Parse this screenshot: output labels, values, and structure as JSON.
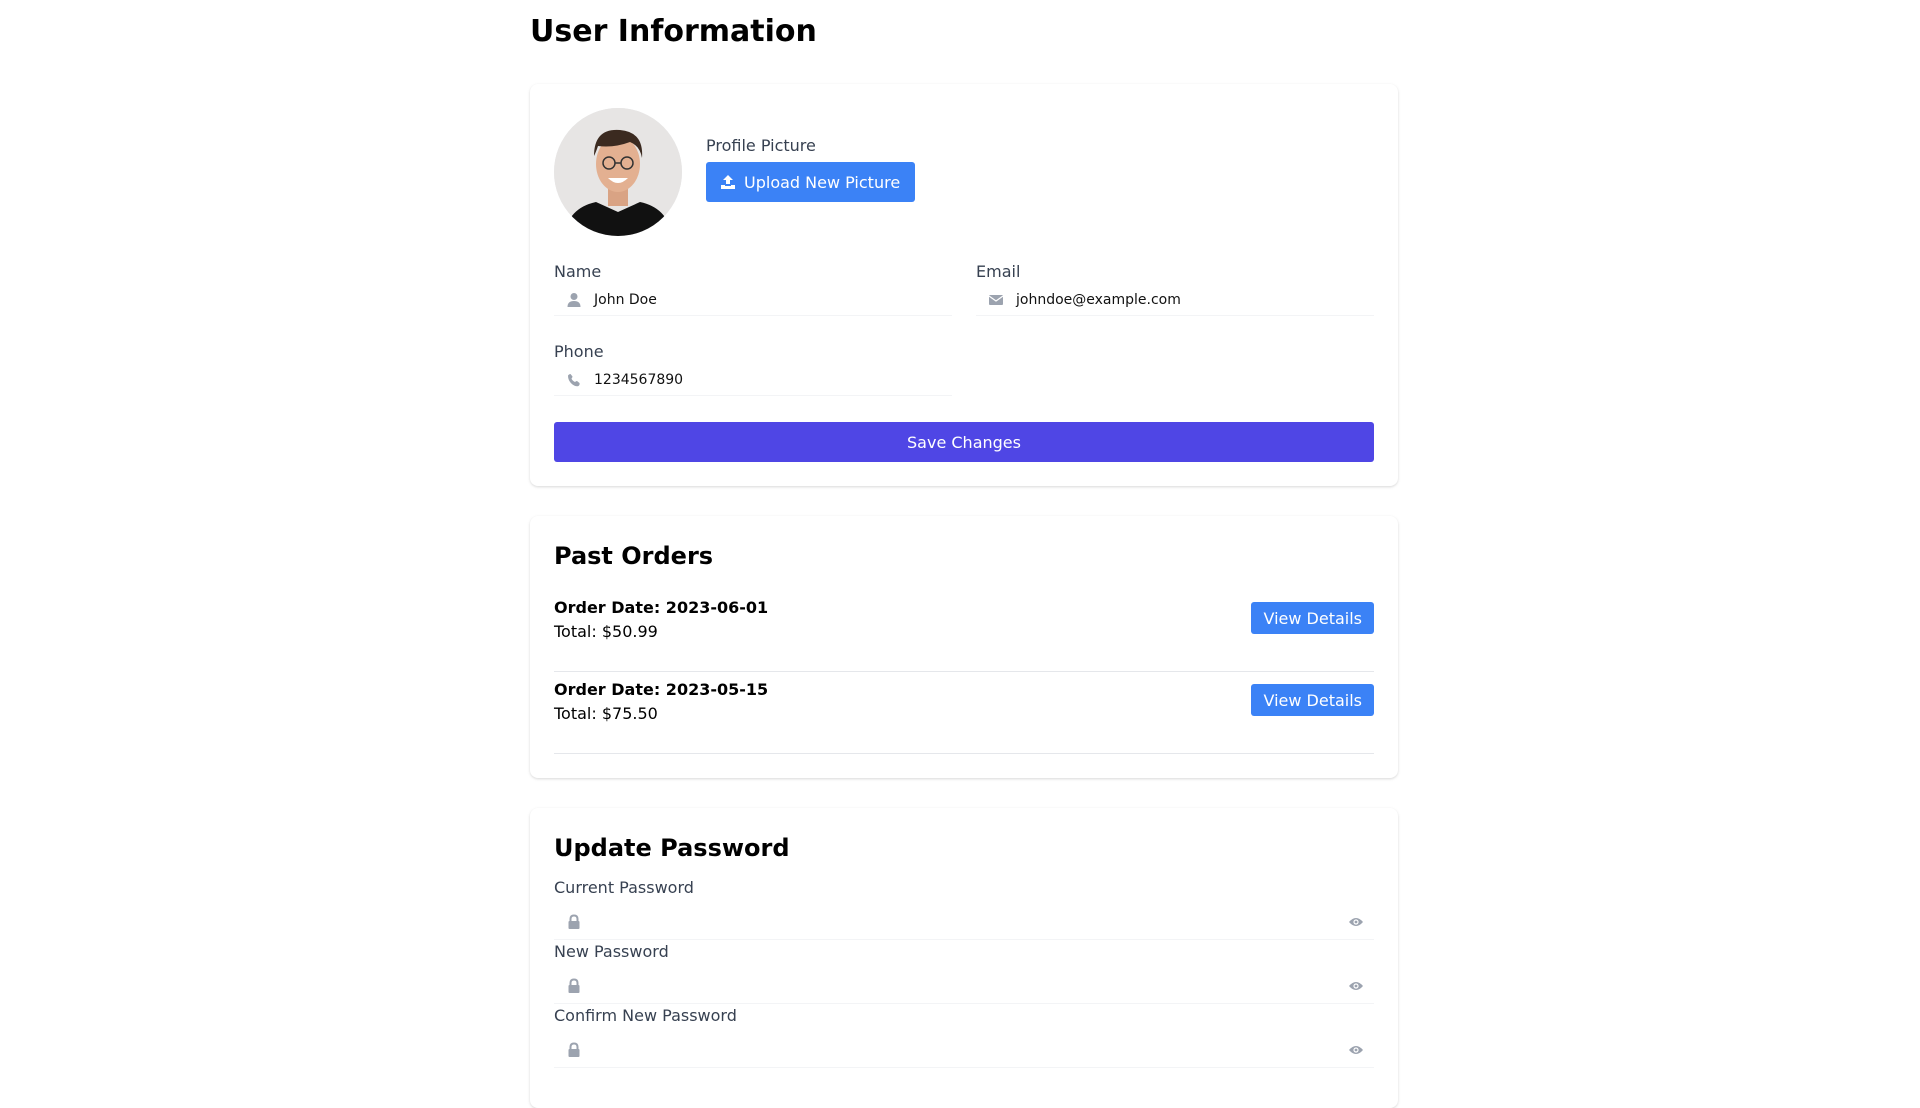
{
  "page": {
    "title": "User Information"
  },
  "profile": {
    "picture_label": "Profile Picture",
    "upload_button": "Upload New Picture",
    "fields": {
      "name": {
        "label": "Name",
        "value": "John Doe",
        "icon": "user-icon"
      },
      "email": {
        "label": "Email",
        "value": "johndoe@example.com",
        "icon": "envelope-icon"
      },
      "phone": {
        "label": "Phone",
        "value": "1234567890",
        "icon": "phone-icon"
      }
    },
    "save_button": "Save Changes"
  },
  "orders": {
    "title": "Past Orders",
    "items": [
      {
        "date": "Order Date: 2023-06-01",
        "total": "Total: $50.99",
        "button": "View Details"
      },
      {
        "date": "Order Date: 2023-05-15",
        "total": "Total: $75.50",
        "button": "View Details"
      }
    ]
  },
  "password": {
    "title": "Update Password",
    "fields": [
      {
        "label": "Current Password",
        "icon": "lock-icon",
        "toggle_icon": "eye-icon"
      },
      {
        "label": "New Password",
        "icon": "lock-icon",
        "toggle_icon": "eye-icon"
      },
      {
        "label": "Confirm New Password",
        "icon": "lock-icon",
        "toggle_icon": "eye-icon"
      }
    ]
  },
  "colors": {
    "primary_blue": "#3b82f6",
    "save_indigo": "#4f46e5",
    "icon_gray": "#9ca3af"
  }
}
